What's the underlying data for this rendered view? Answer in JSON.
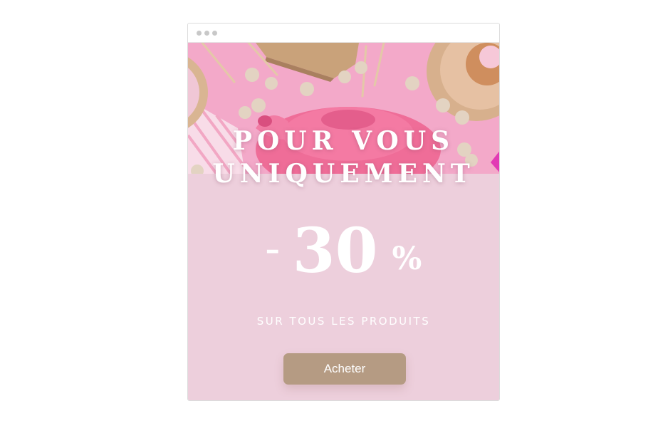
{
  "window": {
    "title_dots": 3
  },
  "popup": {
    "headline_line1": "POUR VOUS",
    "headline_line2": "UNIQUEMENT",
    "discount_prefix": "–",
    "discount_value": "30",
    "discount_unit": "%",
    "subline": "SUR TOUS LES PRODUITS",
    "cta_label": "Acheter"
  },
  "colors": {
    "background": "#edcfdc",
    "hero_pink": "#f0a3c6",
    "button": "#b59b83",
    "text": "#ffffff",
    "accent_tab": "#e23bb4"
  },
  "hero_image": {
    "subject": "pink-teapot-party-flatlay"
  }
}
